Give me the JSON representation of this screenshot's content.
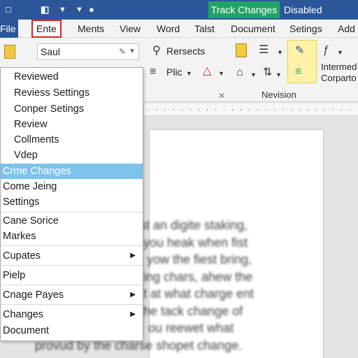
{
  "titlebar": {
    "track_changes_label": "Track Changes",
    "track_status": "Disabled",
    "accent": "#2b579a",
    "track_color": "#21a366"
  },
  "tabs": [
    "File",
    "Ente",
    "Ments",
    "View",
    "Word",
    "Talst",
    "Document",
    "Setings",
    "Add"
  ],
  "ribbon": {
    "style_value": "Saul",
    "resects_label": "Rersects",
    "plic_label": "Plic",
    "group_label": "Nevision",
    "intermed_line1": "Intermed",
    "intermed_line2": "Corparto"
  },
  "menu": {
    "items": [
      "Reviewed",
      "Reviess Settings",
      "Conper Setings",
      "Review",
      "Collments",
      "Vdep",
      "Crme Changes",
      "Come Jeing",
      "Settings",
      "Cane Sorice",
      "Markes",
      "Cupates",
      "Pielp",
      "Cnage Payes",
      "Changes",
      "Document"
    ],
    "highlighted": "Crme Changes",
    "highlight_color": "#7cc4ec"
  },
  "document": {
    "lines": [
      "st an digite staking,",
      "you heak when fist",
      "yow the fiest bring,",
      "ing chars, ahew the",
      "t at what charge ent",
      "the tack change of",
      "ou reewet what",
      "provud by the charse shopet change."
    ]
  }
}
